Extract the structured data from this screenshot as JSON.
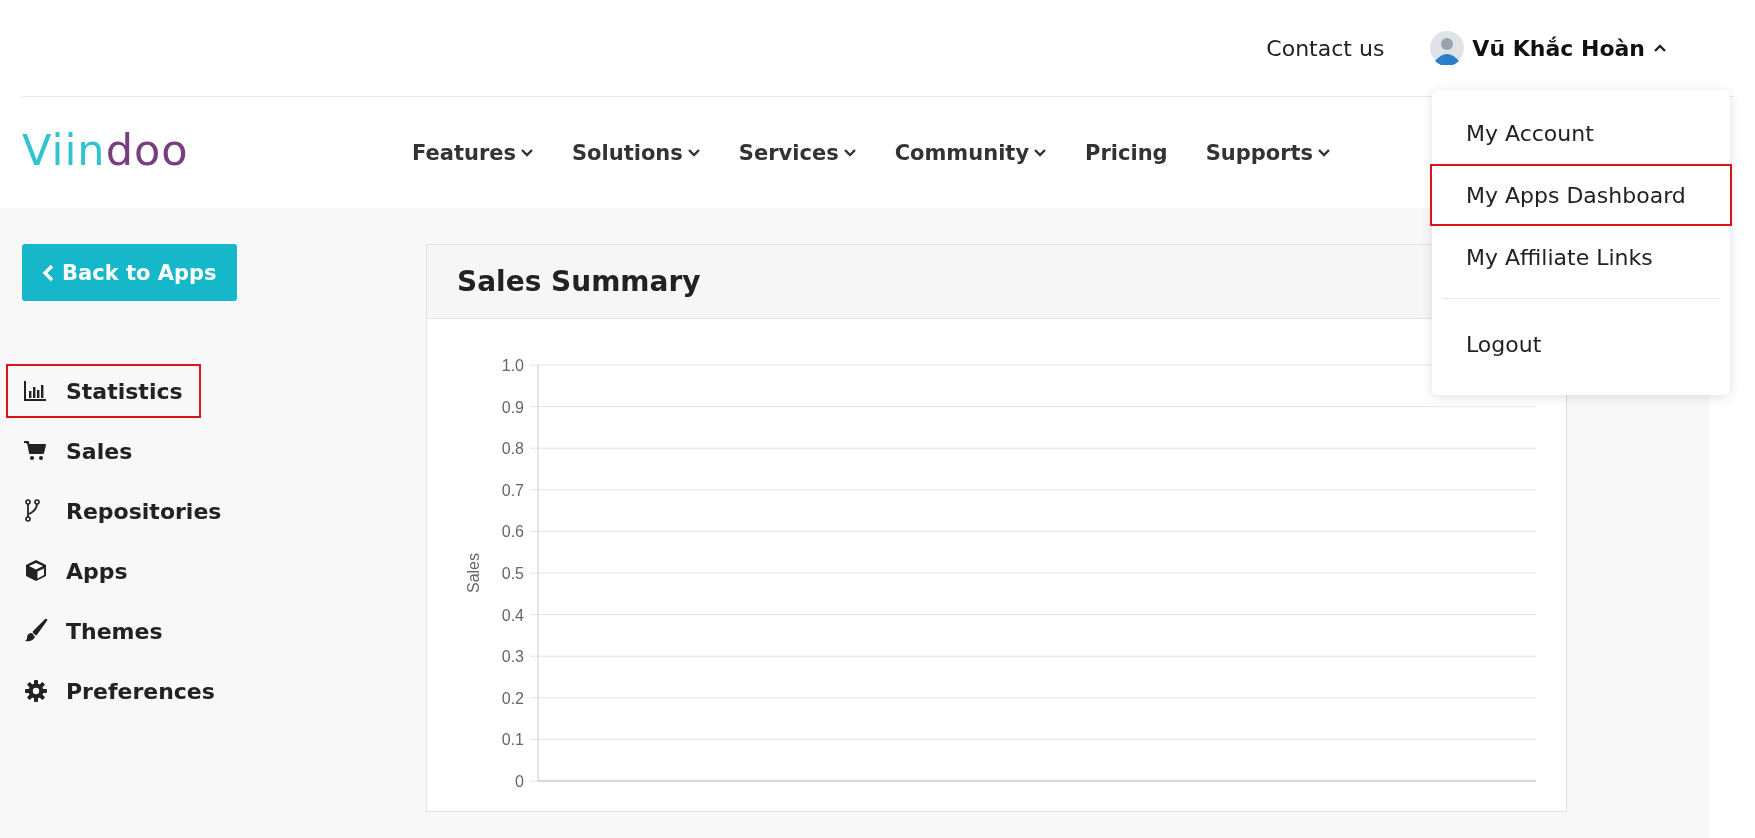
{
  "top_bar": {
    "contact_link": "Contact us",
    "user": {
      "name": "Vũ Khắc Hoàn",
      "expanded": true
    }
  },
  "logo": {
    "parts": [
      {
        "text": "Viin",
        "color": "#2fc3d3"
      },
      {
        "text": "doo",
        "color": "#76407f"
      }
    ]
  },
  "nav": [
    {
      "label": "Features",
      "has_dropdown": true
    },
    {
      "label": "Solutions",
      "has_dropdown": true
    },
    {
      "label": "Services",
      "has_dropdown": true
    },
    {
      "label": "Community",
      "has_dropdown": true
    },
    {
      "label": "Pricing",
      "has_dropdown": false
    },
    {
      "label": "Supports",
      "has_dropdown": true
    }
  ],
  "user_menu": [
    {
      "label": "My Account",
      "highlighted": false,
      "divider_before": false
    },
    {
      "label": "My Apps Dashboard",
      "highlighted": true,
      "divider_before": false
    },
    {
      "label": "My Affiliate Links",
      "highlighted": false,
      "divider_before": false
    },
    {
      "label": "Logout",
      "highlighted": false,
      "divider_before": true
    }
  ],
  "back_button": "Back to Apps",
  "sidebar": {
    "items": [
      {
        "label": "Statistics",
        "highlighted": true
      },
      {
        "label": "Sales",
        "highlighted": false
      },
      {
        "label": "Repositories",
        "highlighted": false
      },
      {
        "label": "Apps",
        "highlighted": false
      },
      {
        "label": "Themes",
        "highlighted": false
      },
      {
        "label": "Preferences",
        "highlighted": false
      }
    ]
  },
  "panel": {
    "title": "Sales Summary",
    "empty_chart": {
      "y_axis_title": "Sales",
      "y_axis_labels": [
        "1.0",
        "0.9",
        "0.8",
        "0.7",
        "0.6",
        "0.5",
        "0.4",
        "0.3",
        "0.2",
        "0.1",
        "0"
      ]
    }
  }
}
